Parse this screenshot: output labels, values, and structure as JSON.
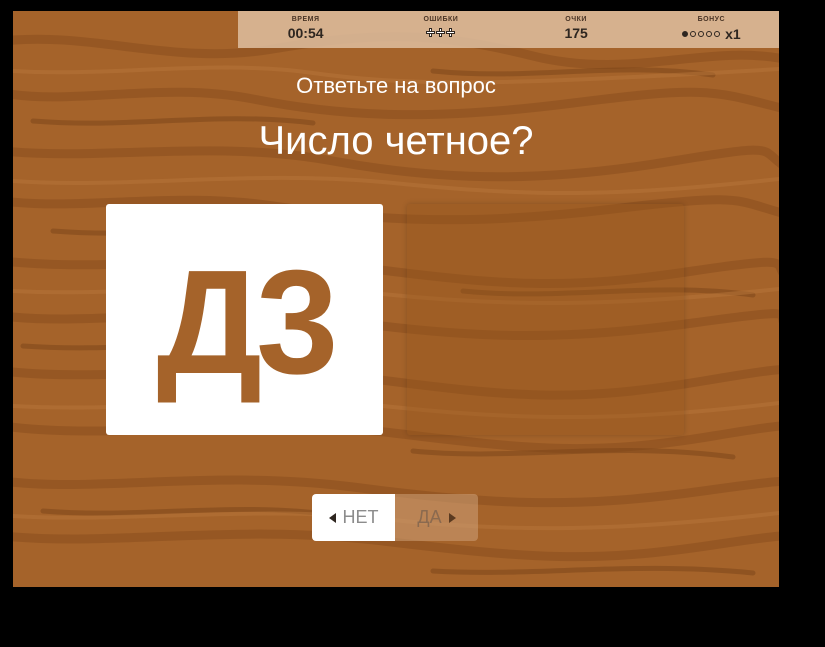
{
  "hud": {
    "time_label": "ВРЕМЯ",
    "time_value": "00:54",
    "mistakes_label": "ОШИБКИ",
    "mistakes_icons": [
      "cross-icon",
      "cross-icon",
      "cross-icon"
    ],
    "score_label": "ОЧКИ",
    "score_value": "175",
    "bonus_label": "БОНУС",
    "bonus_filled": 1,
    "bonus_total": 5,
    "bonus_multiplier": "x1"
  },
  "prompt": "Ответьте на вопрос",
  "question": "Число четное?",
  "card": {
    "text": "Д3"
  },
  "buttons": {
    "no_label": "НЕТ",
    "yes_label": "ДА",
    "no_icon": "arrow-left-icon",
    "yes_icon": "arrow-right-icon"
  },
  "colors": {
    "wood": "#a5632a",
    "card_text": "#a5632a",
    "hud_bg": "#debea0",
    "text_light": "#ffffff"
  }
}
